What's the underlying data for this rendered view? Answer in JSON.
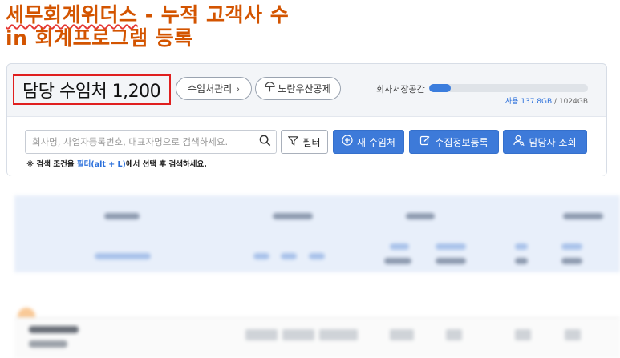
{
  "headline": {
    "line1_brand": "세무회계위더스",
    "line1_rest": " - 누적 고객사 수",
    "line2": "in 회계프로그램 등록"
  },
  "header": {
    "title": "담당 수임처 1,200",
    "mgmt_label": "수임처관리",
    "fund_label": "노란우산공제",
    "storage_label": "회사저장공간",
    "storage_used": "사용 137.8GB",
    "storage_total": "/ 1024GB",
    "storage_fraction": 0.1346
  },
  "search": {
    "placeholder": "회사명, 사업자등록번호, 대표자명으로 검색하세요."
  },
  "toolbar": {
    "filter_label": "필터",
    "new_client_label": "새 수임처",
    "collect_label": "수집정보등록",
    "manager_label": "담당자 조회"
  },
  "hint": {
    "prefix": "※ 검색 조건을 ",
    "shortcut": "필터(alt + L)",
    "suffix": "에서 선택 후 검색하세요."
  },
  "icons": {
    "search": "magnifier-icon",
    "filter": "funnel-icon",
    "new": "plus-circle-icon",
    "collect": "edit-icon",
    "manager": "person-search-icon",
    "fund": "umbrella-icon",
    "chevron": "chevron-right-icon"
  },
  "colors": {
    "headline": "#d35400",
    "highlight_border": "#e01f1f",
    "primary_button": "#3d7ad9",
    "storage_fill": "#3b7ddd",
    "link": "#2a6fdb"
  }
}
